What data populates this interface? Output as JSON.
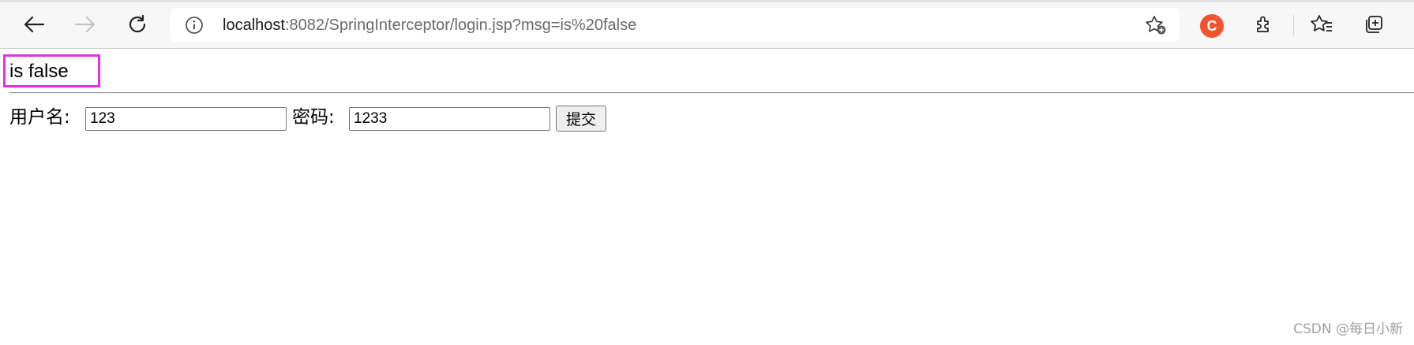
{
  "browser": {
    "address_bar": {
      "url_host": "localhost",
      "url_rest": ":8082/SpringInterceptor/login.jsp?msg=is%20false"
    },
    "extension_badge": "C",
    "accent_colors": {
      "extension_badge": "#f2542f",
      "highlight_box": "#e52ee5"
    }
  },
  "page": {
    "message": "is false",
    "form": {
      "username_label": "用户名:",
      "username_value": "123",
      "password_label": "密码:",
      "password_value": "1233",
      "submit_label": "提交"
    }
  },
  "watermark": "CSDN @每日小新",
  "icons": [
    "back-icon",
    "forward-icon",
    "refresh-icon",
    "info-icon",
    "add-favorite-icon",
    "extensions-icon",
    "favorites-icon",
    "collections-icon"
  ]
}
